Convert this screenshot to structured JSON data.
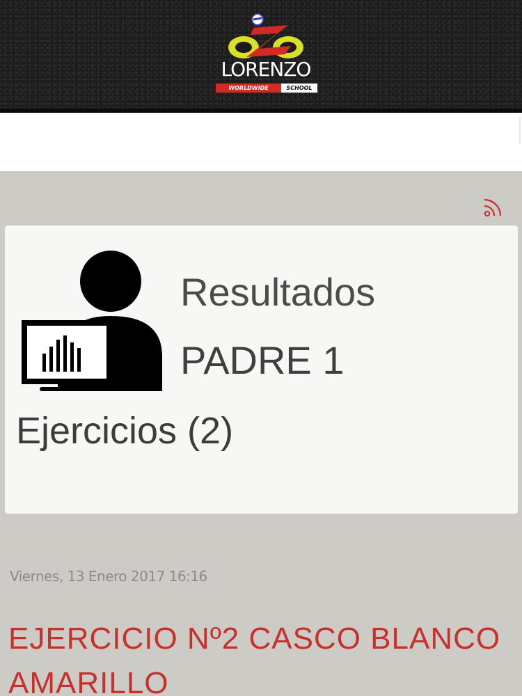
{
  "header": {
    "brand_name": "LORENZO",
    "brand_tag_left": "WORLDWIDE",
    "brand_tag_right": "SCHOOL"
  },
  "feed": {
    "rss_icon": "rss-icon"
  },
  "card": {
    "icon": "user-monitor-icon",
    "title": "Resultados",
    "subtitle": "PADRE 1",
    "category": "Ejercicios (2)"
  },
  "post": {
    "date": "Viernes, 13 Enero 2017 16:16",
    "title": "EJERCICIO Nº2 CASCO BLANCO AMARILLO"
  },
  "colors": {
    "background": "#cdcbc6",
    "accent_red": "#c7312d",
    "header_dark": "#1b1b1b"
  }
}
